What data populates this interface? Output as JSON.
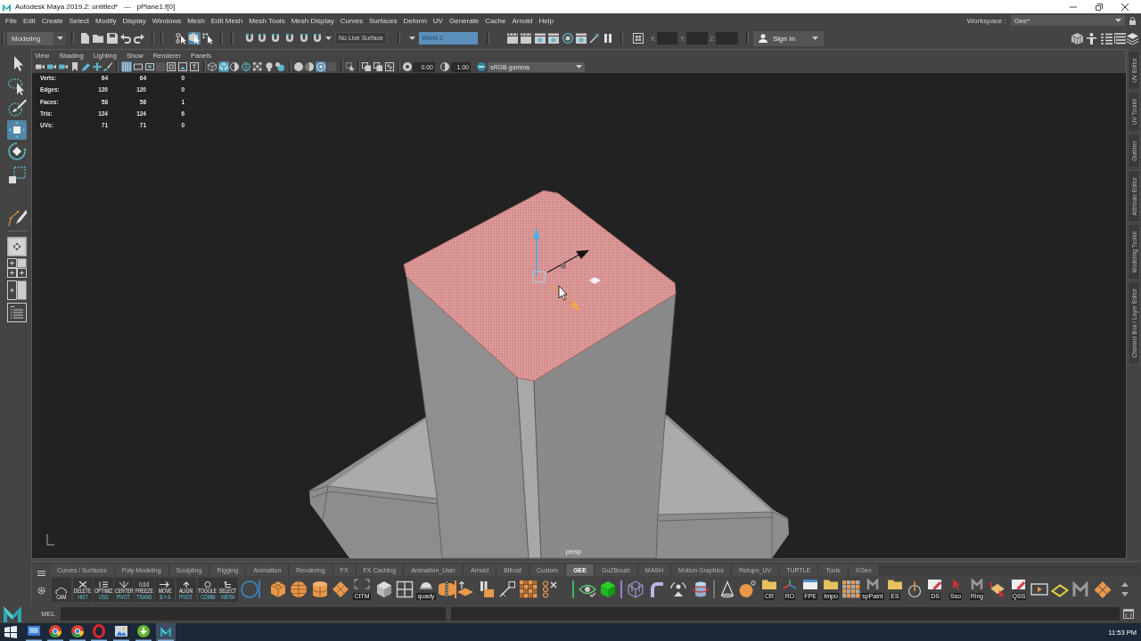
{
  "window": {
    "title": "Autodesk Maya 2019.2: untitled*   ---   pPlane1.f[0]"
  },
  "menu_bar": {
    "items": [
      "File",
      "Edit",
      "Create",
      "Select",
      "Modify",
      "Display",
      "Windows",
      "Mesh",
      "Edit Mesh",
      "Mesh Tools",
      "Mesh Display",
      "Curves",
      "Surfaces",
      "Deform",
      "UV",
      "Generate",
      "Cache",
      "Arnold",
      "Help"
    ],
    "workspace_label": "Workspace :",
    "workspace": "Gee*"
  },
  "status_line": {
    "menu_set": "Modeling",
    "select_modes": [
      {
        "selected": false
      },
      {
        "selected": true
      },
      {
        "selected": false
      }
    ],
    "live_surface": "No Live Surface",
    "axis": "World Z",
    "coordinate_labels": [
      "X:",
      "Y:",
      "Z:"
    ],
    "sign_in": "Sign In"
  },
  "toolbox": {
    "tools": [
      {
        "selected": false
      },
      {
        "selected": false
      },
      {
        "selected": false
      },
      {
        "selected": true
      },
      {
        "selected": false
      },
      {
        "selected": false
      },
      {
        "selected": false
      }
    ]
  },
  "viewport": {
    "menu": [
      "View",
      "Shading",
      "Lighting",
      "Show",
      "Renderer",
      "Panels"
    ],
    "toggles": [
      {
        "on": true
      },
      {
        "on": true
      },
      {
        "on": true
      }
    ],
    "exposure": "0.00",
    "gamma": "1.00",
    "view_transform": "sRGB gamma",
    "hud": [
      {
        "label": "Verts:",
        "values": [
          "64",
          "64",
          "0"
        ]
      },
      {
        "label": "Edges:",
        "values": [
          "120",
          "120",
          "0"
        ]
      },
      {
        "label": "Faces:",
        "values": [
          "58",
          "58",
          "1"
        ]
      },
      {
        "label": "Tris:",
        "values": [
          "124",
          "124",
          "6"
        ]
      },
      {
        "label": "UVs:",
        "values": [
          "71",
          "71",
          "0"
        ]
      }
    ],
    "camera": "persp"
  },
  "side_tabs": [
    "UV Editor",
    "UV Toolkit",
    "Outliner",
    "Attribute Editor",
    "Modeling Toolkit",
    "Channel Box / Layer Editor"
  ],
  "shelf": {
    "tabs": [
      {
        "label": "Curves / Surfaces",
        "selected": false
      },
      {
        "label": "Poly Modeling",
        "selected": false
      },
      {
        "label": "Sculpting",
        "selected": false
      },
      {
        "label": "Rigging",
        "selected": false
      },
      {
        "label": "Animation",
        "selected": false
      },
      {
        "label": "Rendering",
        "selected": false
      },
      {
        "label": "FX",
        "selected": false
      },
      {
        "label": "FX Caching",
        "selected": false
      },
      {
        "label": "Animation_User",
        "selected": false
      },
      {
        "label": "Arnold",
        "selected": false
      },
      {
        "label": "Bifrost",
        "selected": false
      },
      {
        "label": "Custom",
        "selected": false
      },
      {
        "label": "GEE",
        "selected": true
      },
      {
        "label": "GoZBrush",
        "selected": false
      },
      {
        "label": "MASH",
        "selected": false
      },
      {
        "label": "Motion Graphics",
        "selected": false
      },
      {
        "label": "Retopo_UV",
        "selected": false
      },
      {
        "label": "TURTLE",
        "selected": false
      },
      {
        "label": "Tools",
        "selected": false
      },
      {
        "label": "XGen",
        "selected": false
      }
    ],
    "buttons": [
      {
        "lines": [
          "CAM"
        ]
      },
      {
        "lines": [
          "DELETE",
          "HIST"
        ]
      },
      {
        "lines": [
          "OPTIMIZ",
          "OSS"
        ]
      },
      {
        "lines": [
          "CENTER",
          "PIVOT"
        ]
      },
      {
        "lines": [
          "0.0.0",
          "FREEZE",
          "TRANS"
        ]
      },
      {
        "lines": [
          "MOVE",
          "B » A"
        ]
      },
      {
        "lines": [
          "ALIGN",
          "PIVOT"
        ]
      },
      {
        "lines": [
          "TOGGLE",
          "COMBI"
        ]
      },
      {
        "lines": [
          "SELECT",
          "HIERA"
        ]
      },
      {
        "lines": [
          "CtTM"
        ]
      },
      {
        "lines": [
          "quady"
        ]
      },
      {
        "lines": [
          "CR"
        ]
      },
      {
        "lines": [
          "RO"
        ]
      },
      {
        "lines": [
          "FPE"
        ]
      },
      {
        "lines": [
          "Impo"
        ]
      },
      {
        "lines": [
          "spPaint"
        ]
      },
      {
        "lines": [
          "ES"
        ]
      },
      {
        "lines": [
          "DS"
        ]
      },
      {
        "lines": [
          "Sso"
        ]
      },
      {
        "lines": [
          "Ring"
        ]
      },
      {
        "lines": [
          "QSS"
        ]
      }
    ]
  },
  "command_line": {
    "language": "MEL"
  },
  "taskbar": {
    "apps": [
      {
        "selected": false
      },
      {
        "selected": false
      },
      {
        "selected": false
      },
      {
        "selected": false
      },
      {
        "selected": false
      },
      {
        "selected": false
      },
      {
        "selected": true
      }
    ],
    "clock": "11:53 PM"
  }
}
